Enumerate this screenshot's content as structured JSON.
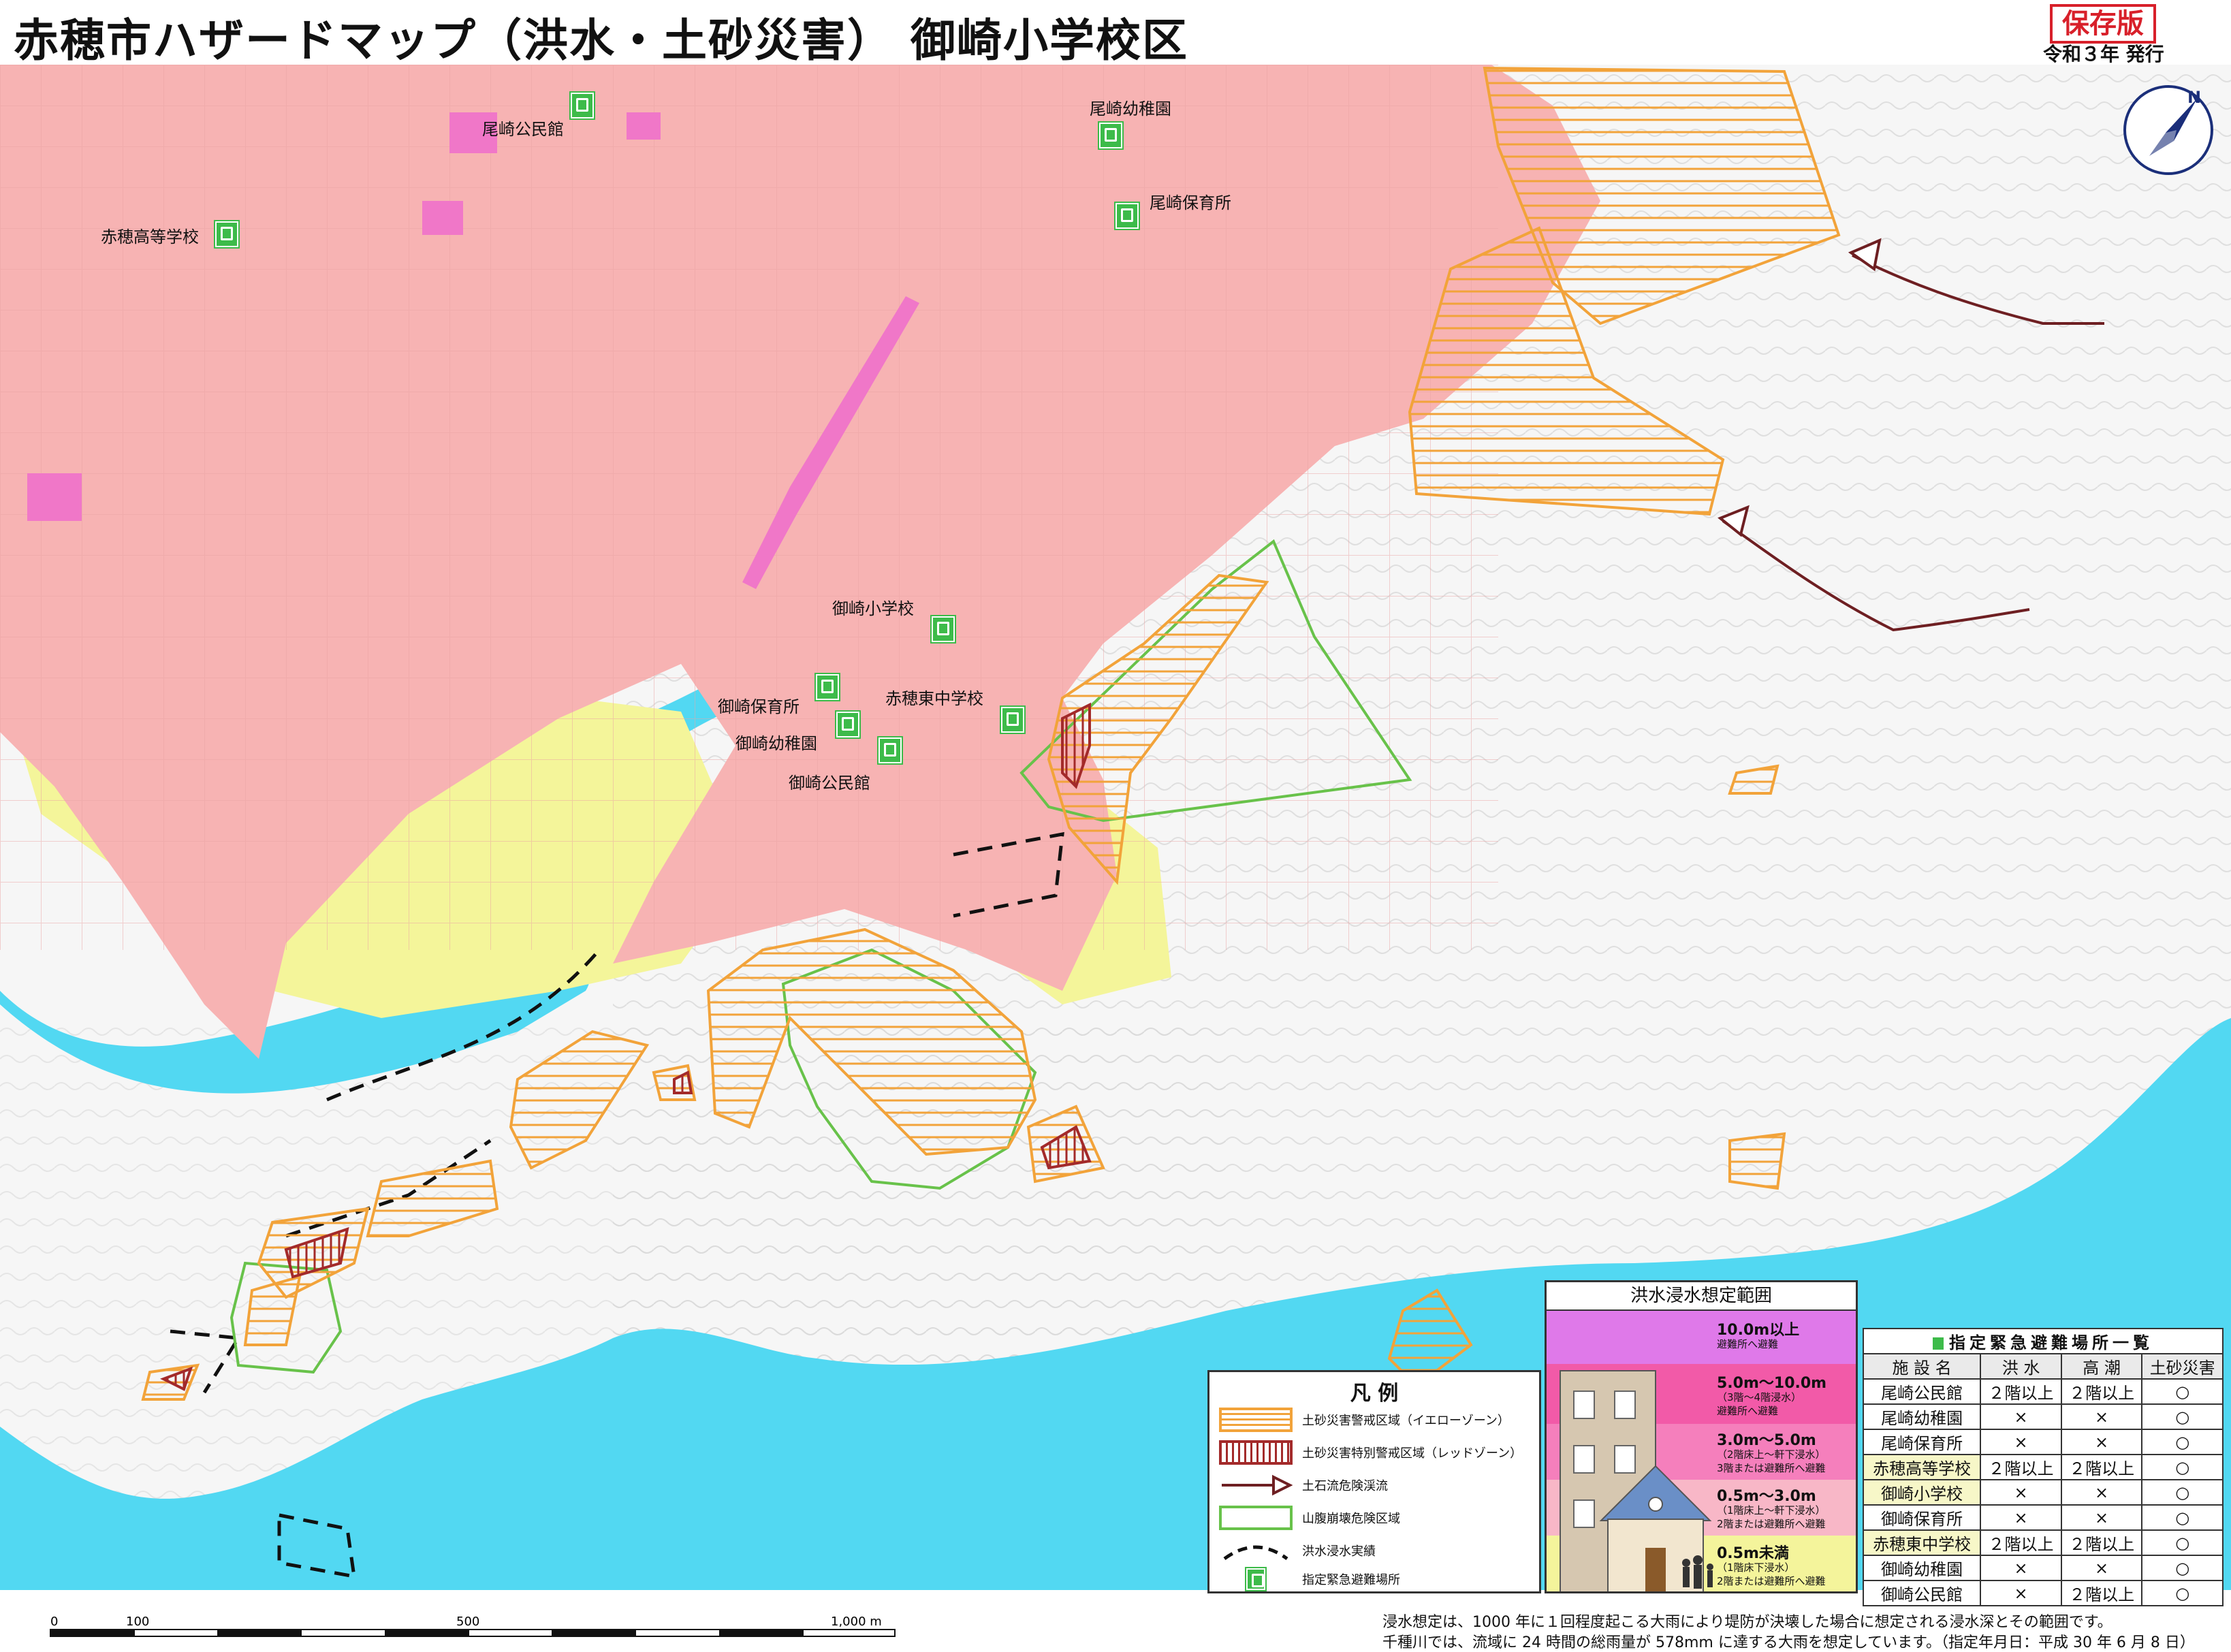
{
  "header": {
    "title": "赤穂市ハザードマップ（洪水・土砂災害） 御崎小学校区",
    "badge": "保存版",
    "issued": "令和３年 発行"
  },
  "map": {
    "places": [
      {
        "id": "ozaki-kominkan",
        "label": "尾崎公民館"
      },
      {
        "id": "ozaki-yochien",
        "label": "尾崎幼稚園"
      },
      {
        "id": "ozaki-hoikusho",
        "label": "尾崎保育所"
      },
      {
        "id": "ako-koko",
        "label": "赤穂高等学校"
      },
      {
        "id": "misaki-shogakko",
        "label": "御崎小学校"
      },
      {
        "id": "misaki-hoikusho",
        "label": "御崎保育所"
      },
      {
        "id": "akohigashi-chugakko",
        "label": "赤穂東中学校"
      },
      {
        "id": "misaki-yochien",
        "label": "御崎幼稚園"
      },
      {
        "id": "misaki-kominkan",
        "label": "御崎公民館"
      }
    ],
    "colors": {
      "sea": "#52d8f2",
      "flood_shallow": "#f4f59a",
      "flood_mid": "#f7b3b3",
      "flood_deep": "#f077c8",
      "yellow_zone": "#f2a33a",
      "red_zone": "#a32a2a",
      "landslide": "#68c24a",
      "debris_flow": "#6e1f22"
    }
  },
  "legend": {
    "title": "凡 例",
    "items": [
      {
        "label": "土砂災害警戒区域（イエローゾーン）"
      },
      {
        "label": "土砂災害特別警戒区域（レッドゾーン）"
      },
      {
        "label": "土石流危険渓流"
      },
      {
        "label": "山腹崩壊危険区域"
      },
      {
        "label": "洪水浸水実績"
      },
      {
        "label": "指定緊急避難場所"
      }
    ]
  },
  "depth": {
    "title": "洪水浸水想定範囲",
    "bands": [
      {
        "range": "10.0m以上",
        "note": "避難所へ避難",
        "color": "#df79e9"
      },
      {
        "range": "5.0m〜10.0m",
        "note": "（3階〜4階浸水）",
        "note2": "避難所へ避難",
        "color": "#f25aa8"
      },
      {
        "range": "3.0m〜5.0m",
        "note": "（2階床上〜軒下浸水）",
        "note2": "3階または避難所へ避難",
        "color": "#f57fbc"
      },
      {
        "range": "0.5m〜3.0m",
        "note": "（1階床上〜軒下浸水）",
        "note2": "2階または避難所へ避難",
        "color": "#f8b7c7"
      },
      {
        "range": "0.5m未満",
        "note": "（1階床下浸水）",
        "note2": "2階または避難所へ避難",
        "color": "#f4f49b"
      }
    ]
  },
  "shelters": {
    "caption": "指定緊急避難場所一覧",
    "headers": [
      "施 設 名",
      "洪 水",
      "高 潮",
      "土砂災害"
    ],
    "rows": [
      [
        "尾崎公民館",
        "２階以上",
        "２階以上",
        "○"
      ],
      [
        "尾崎幼稚園",
        "×",
        "×",
        "○"
      ],
      [
        "尾崎保育所",
        "×",
        "×",
        "○"
      ],
      [
        "赤穂高等学校",
        "２階以上",
        "２階以上",
        "○"
      ],
      [
        "御崎小学校",
        "×",
        "×",
        "○"
      ],
      [
        "御崎保育所",
        "×",
        "×",
        "○"
      ],
      [
        "赤穂東中学校",
        "２階以上",
        "２階以上",
        "○"
      ],
      [
        "御崎幼稚園",
        "×",
        "×",
        "○"
      ],
      [
        "御崎公民館",
        "×",
        "２階以上",
        "○"
      ]
    ]
  },
  "scale": {
    "labels": [
      "0",
      "100",
      "500",
      "1,000 m"
    ]
  },
  "notes": [
    "浸水想定は、1000 年に１回程度起こる大雨により堤防が決壊した場合に想定される浸水深とその範囲です。",
    "千種川では、流域に 24 時間の総雨量が 578mm に達する大雨を想定しています。（指定年月日：平成 30 年 6 月 8 日）"
  ]
}
